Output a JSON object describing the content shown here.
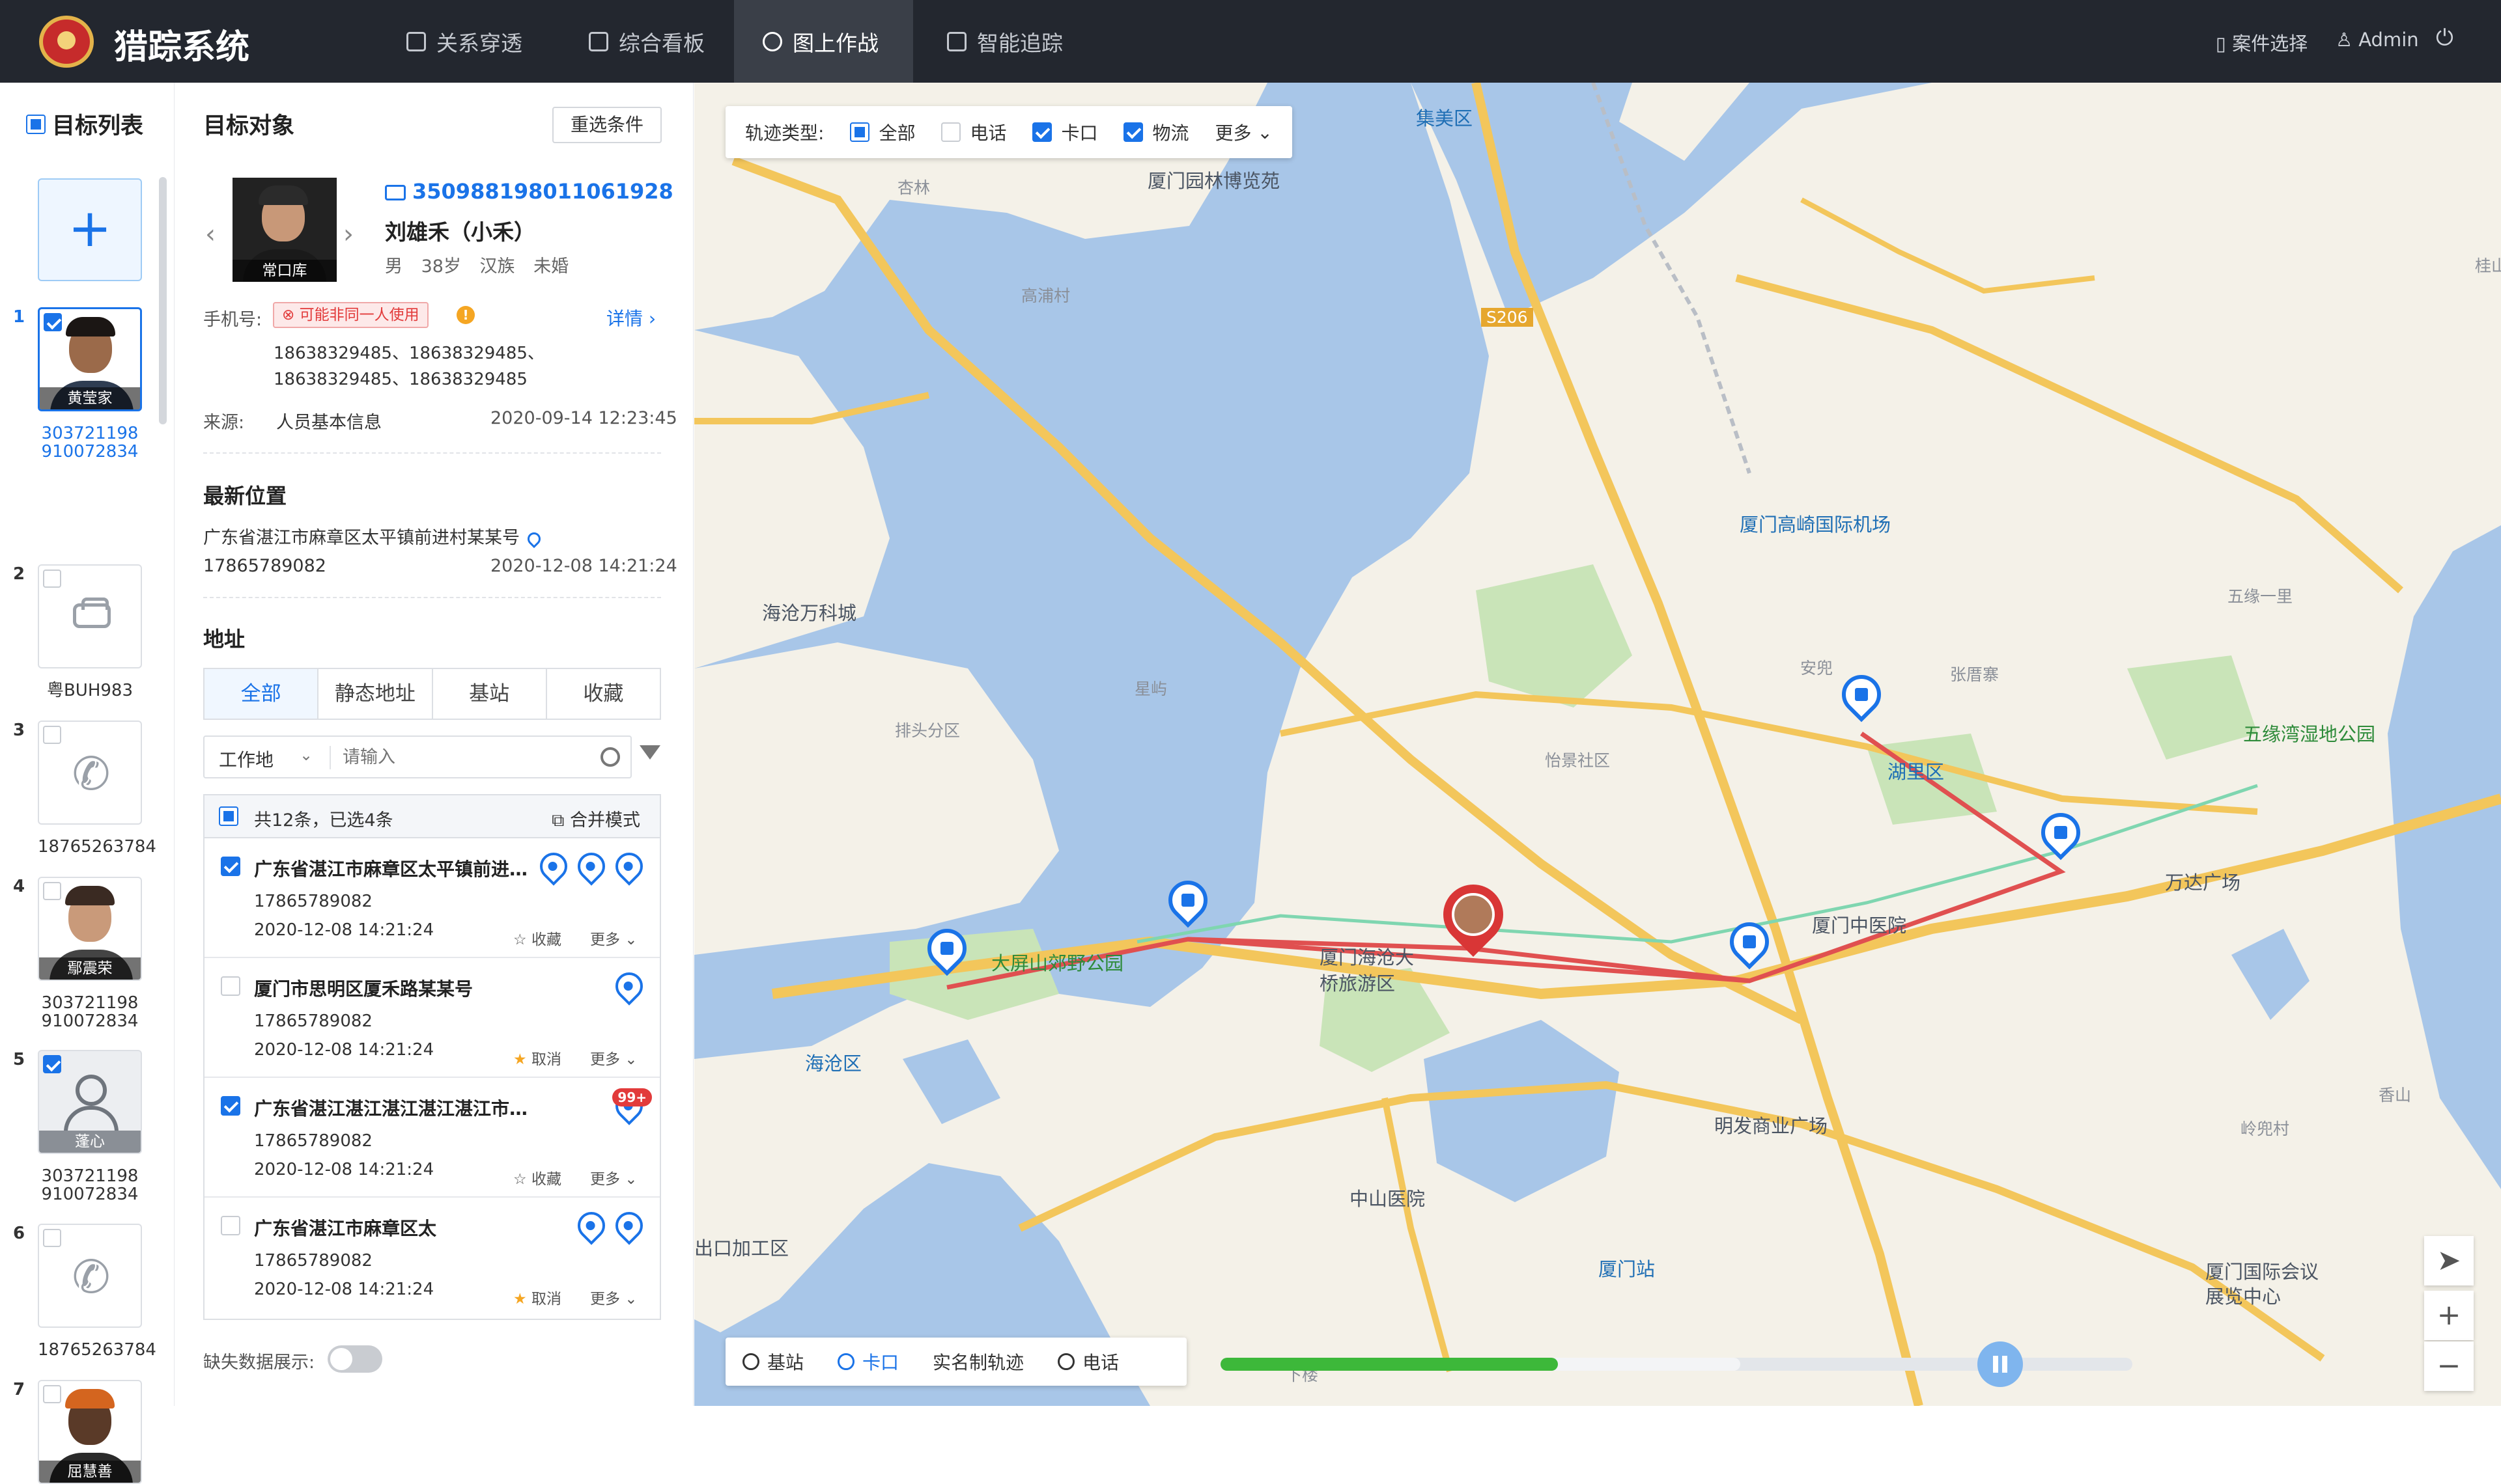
{
  "app": {
    "title": "猎踪系统",
    "logo_icon": "police-badge-icon"
  },
  "nav": [
    {
      "label": "关系穿透",
      "icon": "relation-icon",
      "active": false
    },
    {
      "label": "综合看板",
      "icon": "dashboard-icon",
      "active": false
    },
    {
      "label": "图上作战",
      "icon": "map-battle-icon",
      "active": true
    },
    {
      "label": "智能追踪",
      "icon": "tracking-icon",
      "active": false
    }
  ],
  "topright": {
    "case_select": "案件选择",
    "user": "Admin",
    "power_icon": "power-icon"
  },
  "target_list": {
    "title": "目标列表",
    "items": [
      {
        "num": "1",
        "type": "person",
        "photo_label": "黄莹家",
        "caption": "303721198910072834",
        "checked": true,
        "selected": true
      },
      {
        "num": "2",
        "type": "vehicle",
        "caption": "粤BUH983",
        "checked": false
      },
      {
        "num": "3",
        "type": "phone",
        "caption": "18765263784",
        "checked": false
      },
      {
        "num": "4",
        "type": "person",
        "photo_label": "鄢震荣",
        "caption": "303721198910072834",
        "checked": false
      },
      {
        "num": "5",
        "type": "user",
        "photo_label": "蓬心",
        "caption": "303721198910072834",
        "checked": true
      },
      {
        "num": "6",
        "type": "phone",
        "caption": "18765263784",
        "checked": false
      },
      {
        "num": "7",
        "type": "person",
        "photo_label": "屈慧善",
        "caption": "",
        "checked": false
      }
    ]
  },
  "detail": {
    "title": "目标对象",
    "reset_button": "重选条件",
    "photo_label": "常口库",
    "id_number": "350988198011061928",
    "name": "刘雄禾（小禾）",
    "gender": "男",
    "age": "38岁",
    "ethnicity": "汉族",
    "marital": "未婚",
    "phone_label": "手机号:",
    "warning_tag": "可能非同一人使用",
    "detail_link": "详情",
    "phones": "18638329485、18638329485、18638329485、18638329485",
    "source_label": "来源:",
    "source_value": "人员基本信息",
    "source_time": "2020-09-14  12:23:45",
    "latest_title": "最新位置",
    "latest_addr": "广东省湛江市麻章区太平镇前进村某某号",
    "latest_phone": "17865789082",
    "latest_time": "2020-12-08  14:21:24",
    "address_title": "地址",
    "tabs": [
      "全部",
      "静态地址",
      "基站",
      "收藏"
    ],
    "filter_select": "工作地",
    "search_placeholder": "请输入",
    "summary": "共12条，已选4条",
    "merge_mode": "合并模式",
    "addresses": [
      {
        "title": "广东省湛江市麻章区太平镇前进村某某号",
        "phone": "17865789082",
        "time": "2020-12-08  14:21:24",
        "checked": true,
        "fav": "收藏",
        "fav_on": false,
        "more": "更多",
        "badge": ""
      },
      {
        "title": "厦门市思明区厦禾路某某号",
        "phone": "17865789082",
        "time": "2020-12-08  14:21:24",
        "checked": false,
        "fav": "取消",
        "fav_on": true,
        "more": "更多",
        "badge": ""
      },
      {
        "title": "广东省湛江湛江湛江湛江湛江市麻章区太平镇",
        "phone": "17865789082",
        "time": "2020-12-08  14:21:24",
        "checked": true,
        "fav": "收藏",
        "fav_on": false,
        "more": "更多",
        "badge": "99+"
      },
      {
        "title": "广东省湛江市麻章区太",
        "phone": "17865789082",
        "time": "2020-12-08  14:21:24",
        "checked": false,
        "fav": "取消",
        "fav_on": true,
        "more": "更多",
        "badge": ""
      }
    ],
    "missing_toggle_label": "缺失数据展示:"
  },
  "map": {
    "trajectory_label": "轨迹类型:",
    "filters": [
      {
        "label": "全部",
        "state": "partial"
      },
      {
        "label": "电话",
        "state": "off"
      },
      {
        "label": "卡口",
        "state": "on"
      },
      {
        "label": "物流",
        "state": "on"
      }
    ],
    "more": "更多",
    "labels": {
      "jimei": "集美区",
      "garden": "厦门园林博览苑",
      "xinglin": "杏林",
      "gaopu": "高浦村",
      "s206": "S206",
      "airport": "厦门高崎国际机场",
      "haicang_wanke": "海沧万科城",
      "wuyuan": "五缘一里",
      "anduo": "安兜",
      "zhangcuo": "张厝寨",
      "huli": "湖里区",
      "wuyuan_park": "五缘湾湿地公园",
      "paitou": "排头分区",
      "xingyu": "星屿",
      "yijing": "怡景社区",
      "wanda": "万达广场",
      "dapingshan": "大屏山郊野公园",
      "haicang_bridge": "厦门海沧大桥旅游区",
      "zhongyiyuan": "厦门中医院",
      "haicang": "海沧区",
      "mingfa": "明发商业广场",
      "lingxia": "岭兜村",
      "xiangshan": "香山",
      "zhongshan": "中山医院",
      "export_zone": "出口加工区",
      "xiamen_station": "厦门站",
      "convention": "厦门国际会议展览中心",
      "guishan": "桂山",
      "xialou": "下楼"
    },
    "bottom_tabs": [
      {
        "label": "基站",
        "active": false
      },
      {
        "label": "卡口",
        "active": true
      },
      {
        "label": "实名制轨迹",
        "active": false
      },
      {
        "label": "电话",
        "active": false
      }
    ],
    "playback_progress": 0.37,
    "buffer_progress": 0.57,
    "zoom_in": "+",
    "zoom_out": "−",
    "locate_icon": "navigation-arrow-icon"
  }
}
